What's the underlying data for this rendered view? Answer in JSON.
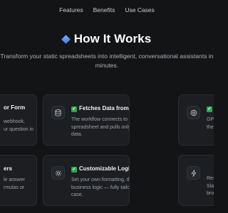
{
  "nav": {
    "features": "Features",
    "benefits": "Benefits",
    "use_cases": "Use Cases"
  },
  "hero": {
    "title": "How It Works",
    "subtitle_line1": "Transform your static spreadsheets into intelligent, conversational assistants in",
    "subtitle_line2": "minutes."
  },
  "cards": {
    "left_top": {
      "heading": "or Form",
      "desc_line1": "webhook,",
      "desc_line2": "ur question in"
    },
    "mid_top": {
      "heading": "Fetches Data from Google Sheets",
      "desc_line1": "The workflow connects to your selected",
      "desc_line2": "spreadsheet and pulls only the relevant",
      "desc_line3": "data."
    },
    "right_top": {
      "heading": "U",
      "desc_line1": "GPT",
      "desc_line2": "the"
    },
    "left_bottom": {
      "heading": "ers",
      "desc_line1": "le answer",
      "desc_line2": "rmulas or"
    },
    "mid_bottom": {
      "heading": "Customizable Logic & Filters",
      "desc_line1": "Set your own formatting, thresholds, or",
      "desc_line2": "business logic — fully tailored to your use",
      "desc_line3": "case."
    },
    "right_bottom": {
      "heading": "",
      "desc_line1": "Res",
      "desc_line2": "Slac",
      "desc_line3": "brow"
    }
  },
  "icons": {
    "title": "blue-diamond-icon",
    "mid_top": "database-icon",
    "right_top": "ai-brain-icon",
    "mid_bottom": "gear-icon",
    "right_bottom": "lightning-icon",
    "check": "check-mark-icon"
  },
  "colors": {
    "background": "#131416",
    "card": "#1c1e21",
    "check_green": "#2fa84f",
    "accent_blue": "#3b7be8"
  }
}
